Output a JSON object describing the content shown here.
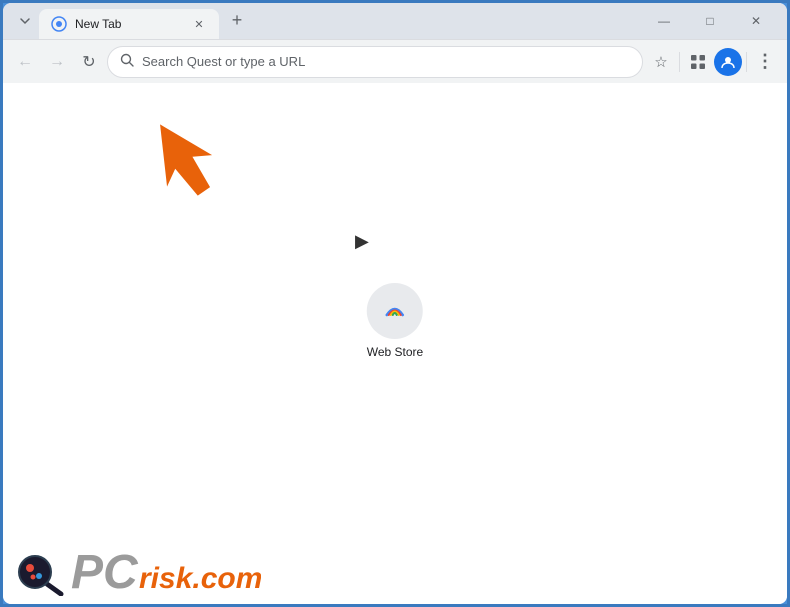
{
  "window": {
    "title": "New Tab",
    "controls": {
      "minimize": "—",
      "maximize": "□",
      "close": "✕"
    }
  },
  "tab": {
    "title": "New Tab",
    "favicon": "circle"
  },
  "toolbar": {
    "back_label": "←",
    "forward_label": "→",
    "refresh_label": "↻",
    "address_placeholder": "Search Quest or type a URL",
    "bookmark_label": "☆",
    "extensions_label": "🧩",
    "profile_label": "👤",
    "menu_label": "⋮",
    "new_tab_label": "+"
  },
  "page": {
    "shortcut": {
      "label": "Web Store"
    }
  },
  "watermark": {
    "text": "PCrisk.com"
  },
  "colors": {
    "accent_blue": "#1a73e8",
    "border_blue": "#4a90d9",
    "tab_bg": "#f1f3f4",
    "chrome_bg": "#dee3ea",
    "orange_arrow": "#e8620a"
  }
}
